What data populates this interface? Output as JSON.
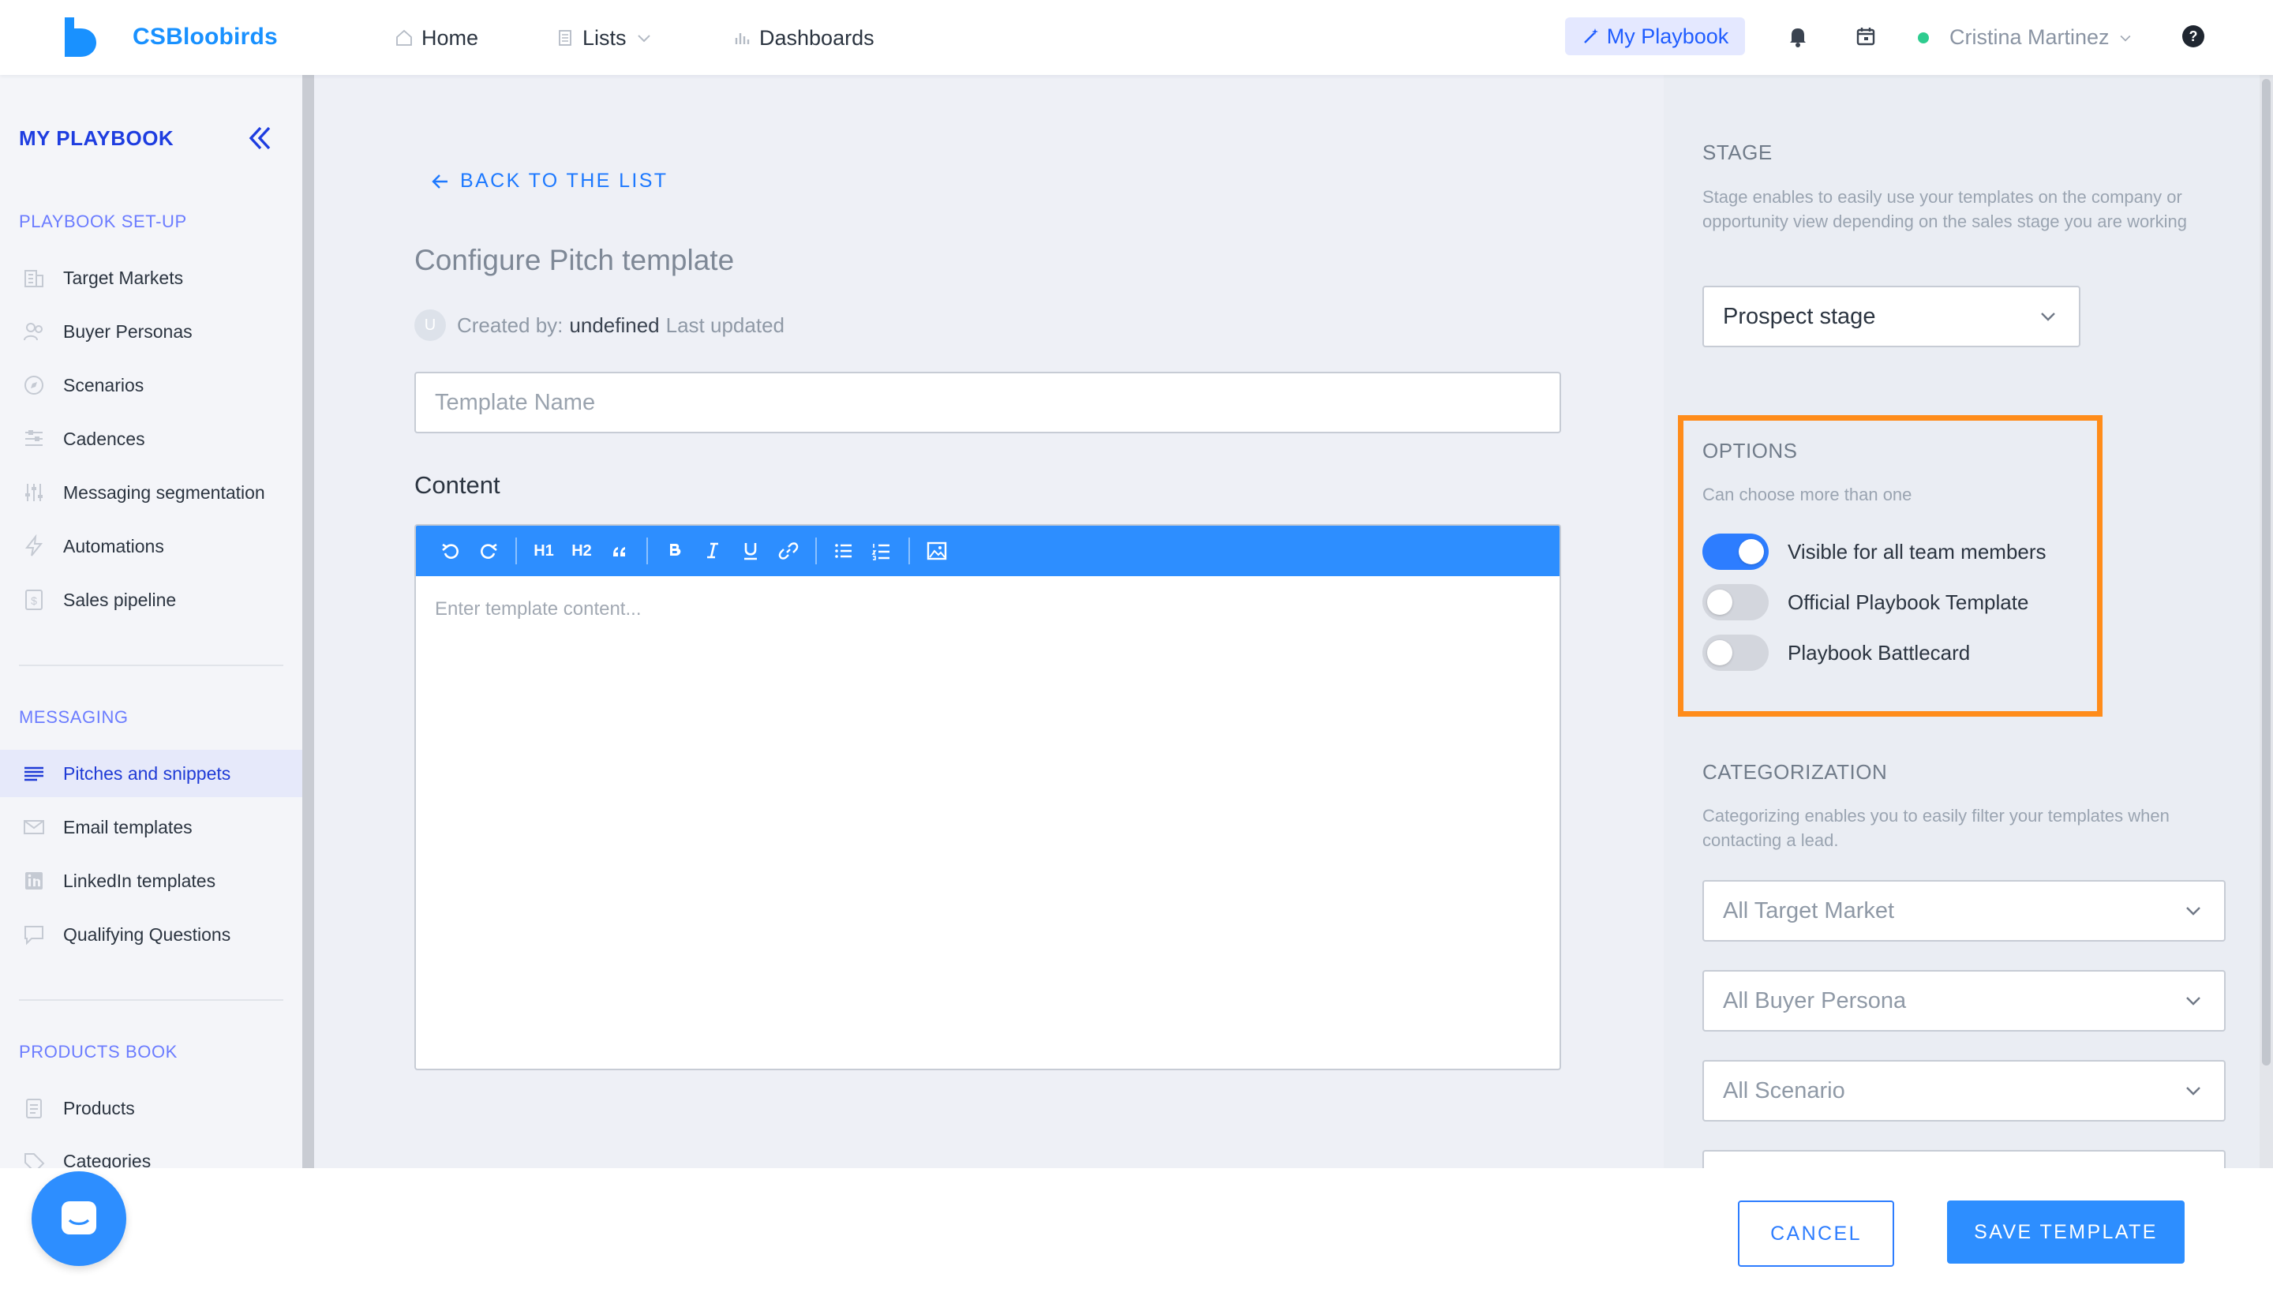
{
  "app": {
    "brand": "CSBloobirds"
  },
  "nav": {
    "home": "Home",
    "lists": "Lists",
    "dashboards": "Dashboards",
    "my_playbook": "My Playbook"
  },
  "user": {
    "name": "Cristina Martinez"
  },
  "sidebar": {
    "title": "MY PLAYBOOK",
    "sections": [
      {
        "heading": "PLAYBOOK SET-UP",
        "items": [
          {
            "label": "Target Markets",
            "icon": "building-icon"
          },
          {
            "label": "Buyer Personas",
            "icon": "people-icon"
          },
          {
            "label": "Scenarios",
            "icon": "compass-icon"
          },
          {
            "label": "Cadences",
            "icon": "cadence-icon"
          },
          {
            "label": "Messaging segmentation",
            "icon": "sliders-icon"
          },
          {
            "label": "Automations",
            "icon": "bolt-icon"
          },
          {
            "label": "Sales pipeline",
            "icon": "dollar-icon"
          }
        ]
      },
      {
        "heading": "MESSAGING",
        "items": [
          {
            "label": "Pitches and snippets",
            "icon": "lines-icon",
            "active": true
          },
          {
            "label": "Email templates",
            "icon": "mail-icon"
          },
          {
            "label": "LinkedIn templates",
            "icon": "linkedin-icon"
          },
          {
            "label": "Qualifying Questions",
            "icon": "chat-bubble-icon"
          }
        ]
      },
      {
        "heading": "PRODUCTS BOOK",
        "items": [
          {
            "label": "Products",
            "icon": "clipboard-icon"
          },
          {
            "label": "Categories",
            "icon": "tag-icon"
          }
        ]
      }
    ]
  },
  "main": {
    "back_label": "BACK TO THE LIST",
    "title": "Configure Pitch template",
    "avatar_initial": "U",
    "created_by_label": "Created by:",
    "created_by_value": "undefined",
    "last_updated_label": "Last updated",
    "template_name_placeholder": "Template Name",
    "content_label": "Content",
    "editor_placeholder": "Enter template content...",
    "toolbar": {
      "h1": "H1",
      "h2": "H2"
    }
  },
  "right": {
    "stage": {
      "heading": "STAGE",
      "description": "Stage enables to easily use your templates on the company or opportunity view depending on the sales stage you are working",
      "selected": "Prospect stage"
    },
    "options": {
      "heading": "OPTIONS",
      "hint": "Can choose more than one",
      "toggles": [
        {
          "label": "Visible for all team members",
          "on": true
        },
        {
          "label": "Official Playbook Template",
          "on": false
        },
        {
          "label": "Playbook Battlecard",
          "on": false
        }
      ]
    },
    "categorization": {
      "heading": "CATEGORIZATION",
      "description": "Categorizing enables you to easily filter your templates when contacting a lead.",
      "selects": [
        "All Target Market",
        "All Buyer Persona",
        "All Scenario"
      ]
    }
  },
  "footer": {
    "cancel": "CANCEL",
    "save": "SAVE TEMPLATE"
  },
  "colors": {
    "accent": "#2d8eff",
    "brand": "#1991ff",
    "highlight": "#ff8c1a",
    "toggle_on": "#2d7dff"
  }
}
